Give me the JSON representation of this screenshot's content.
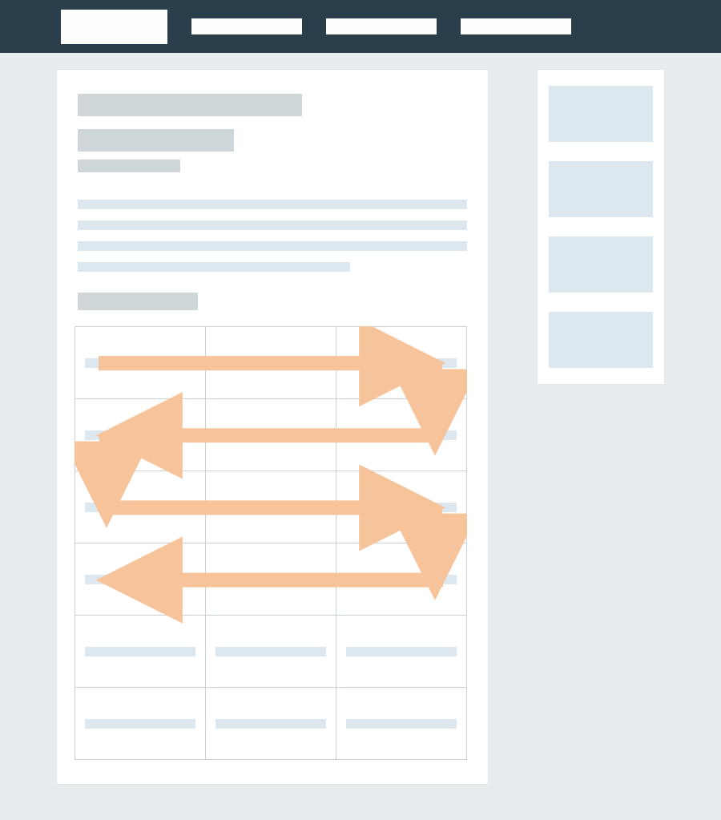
{
  "diagram": {
    "purpose": "wireframe illustrating left-to-right / right-to-left serpentine reading-order flow through a 3-column grid",
    "arrow_color": "#f6c39a",
    "flow_pattern": "LTR-down-RTL-down-LTR-down-RTL",
    "placeholder_blue": "#dce7ef",
    "placeholder_grey": "#cfd6da"
  },
  "topbar": {
    "logo": "",
    "items": [
      "",
      "",
      ""
    ]
  },
  "article": {
    "title": "",
    "subtitle": "",
    "meta": "",
    "paragraph_lines": [
      "",
      "",
      "",
      ""
    ],
    "section_heading": ""
  },
  "sidebar": {
    "blocks": [
      "",
      "",
      "",
      ""
    ]
  },
  "table": {
    "rows": 6,
    "cols": 3,
    "cells": [
      [
        "",
        "",
        ""
      ],
      [
        "",
        "",
        ""
      ],
      [
        "",
        "",
        ""
      ],
      [
        "",
        "",
        ""
      ],
      [
        "",
        "",
        ""
      ],
      [
        "",
        "",
        ""
      ]
    ]
  }
}
